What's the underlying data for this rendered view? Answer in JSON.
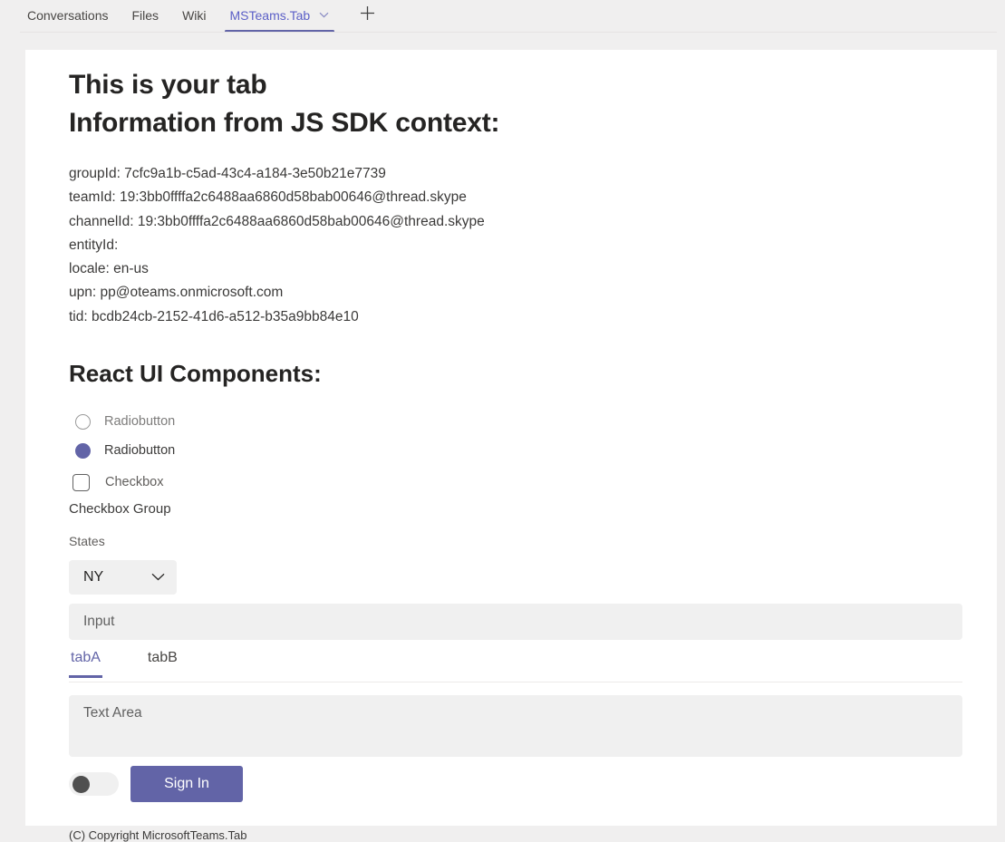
{
  "channel_tabs": {
    "items": [
      {
        "label": "Conversations",
        "active": false
      },
      {
        "label": "Files",
        "active": false
      },
      {
        "label": "Wiki",
        "active": false
      },
      {
        "label": "MSTeams.Tab",
        "active": true
      }
    ],
    "add_tab_label": "+"
  },
  "page": {
    "title": "This is your tab",
    "subtitle": "Information from JS SDK context:"
  },
  "context": {
    "lines": [
      "groupId: 7cfc9a1b-c5ad-43c4-a184-3e50b21e7739",
      "teamId: 19:3bb0ffffa2c6488aa6860d58bab00646@thread.skype",
      "channelId: 19:3bb0ffffa2c6488aa6860d58bab00646@thread.skype",
      "entityId:",
      "locale: en-us",
      "upn: pp@oteams.onmicrosoft.com",
      "tid: bcdb24cb-2152-41d6-a512-b35a9bb84e10"
    ]
  },
  "components": {
    "heading": "React UI Components:",
    "radios": [
      {
        "label": "Radiobutton",
        "checked": false
      },
      {
        "label": "Radiobutton",
        "checked": true
      }
    ],
    "checkbox": {
      "label": "Checkbox",
      "checked": false
    },
    "checkbox_group_label": "Checkbox Group",
    "states": {
      "label": "States",
      "selected": "NY",
      "options": [
        "NY"
      ]
    },
    "input": {
      "placeholder": "Input",
      "value": ""
    },
    "mini_tabs": [
      {
        "label": "tabA",
        "active": true
      },
      {
        "label": "tabB",
        "active": false
      }
    ],
    "textarea": {
      "placeholder": "Text Area",
      "value": ""
    },
    "toggle": {
      "state": "off"
    },
    "signin_label": "Sign In"
  },
  "footer": {
    "copyright": "(C) Copyright MicrosoftTeams.Tab"
  },
  "colors": {
    "accent": "#6264a7",
    "accent_text": "#5b5fc7",
    "page_bg": "#f0efef",
    "panel_bg": "#ffffff",
    "field_bg": "#f0f0f0",
    "toggle_knob": "#4f4f4f"
  }
}
